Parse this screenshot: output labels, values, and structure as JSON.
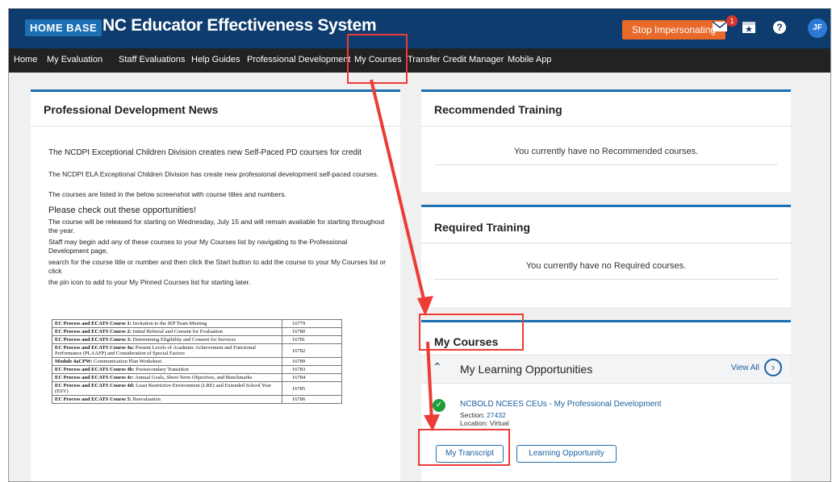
{
  "header": {
    "logo": "HOME BASE",
    "title": "NC Educator Effectiveness System",
    "stop_button": "Stop Impersonating",
    "mail_badge": "1",
    "avatar": "JF",
    "help_icon": "?"
  },
  "nav": [
    "Home",
    "My Evaluation",
    "Staff Evaluations",
    "Help Guides",
    "Professional Development",
    "My Courses",
    "Transfer Credit Manager",
    "Mobile App"
  ],
  "news": {
    "title": "Professional Development News",
    "headline": "The NCDPI Exceptional Children Division creates new Self-Paced PD courses for credit",
    "p1": "The NCDPI ELA Exceptional Children Division has create new professional development self-paced courses.",
    "p2": "The courses are listed in the below screenshot with course titles and numbers.",
    "subhead": "Please check out these opportunities!",
    "p3": "The course will be released for starting on Wednesday, July 15 and will remain available for starting throughout the year.",
    "p4": "Staff may begin add any of these courses to your My Courses list by navigating to the Professional Development page,",
    "p5": "search for the course title or number and then click the Start button to add the course to your My Courses list or click",
    "p6": "the pin icon to add to your My Pinned Courses list for starting later.",
    "courses": [
      {
        "bold": "EC Process and ECATS Course 1:",
        "rest": " Invitation to the IEP Team Meeting",
        "num": "16779"
      },
      {
        "bold": "EC Process and ECATS Course 2:",
        "rest": " Initial Referral and Consent for Evaluation",
        "num": "16780"
      },
      {
        "bold": "EC Process and ECATS Course 3:",
        "rest": " Determining Eligibility and Consent for Services",
        "num": "16781"
      },
      {
        "bold": "EC Process and ECATS Course 4a:",
        "rest": " Present Levels of Academic Achievement and Functional Performance (PLAAFP) and Consideration of Special Factors",
        "num": "16782"
      },
      {
        "bold": "Module 4aCPW:",
        "rest": " Communication Plan Worksheet",
        "num": "16789"
      },
      {
        "bold": "EC Process and ECATS Course 4b:",
        "rest": " Postsecondary Transition",
        "num": "16783"
      },
      {
        "bold": "EC Process and ECATS Course 4c:",
        "rest": " Annual Goals, Short-Term Objectives, and Benchmarks",
        "num": "16784"
      },
      {
        "bold": "EC Process and ECATS Course 4d:",
        "rest": " Least Restrictive Environment (LRE) and Extended School Year (ESY)",
        "num": "16785"
      },
      {
        "bold": "EC Process and ECATS Course 5:",
        "rest": " Reevaluation",
        "num": "16786"
      }
    ]
  },
  "recommended": {
    "title": "Recommended Training",
    "message": "You currently have no Recommended courses."
  },
  "required": {
    "title": "Required Training",
    "message": "You currently have no Required courses."
  },
  "my_courses": {
    "title": "My Courses",
    "section_title": "My Learning Opportunities",
    "view_all": "View All",
    "course_name": "NCBOLD NCEES CEUs - My Professional Development",
    "section_label": "Section: ",
    "section_value": "27432",
    "location": "Location: Virtual",
    "transcript_button": "My Transcript",
    "learning_button": "Learning Opportunity"
  },
  "colors": {
    "header": "#0e3c6e",
    "nav": "#222222",
    "accent": "#1b6fb3",
    "stop": "#e8692a",
    "highlight": "#ee3b36",
    "success": "#1e9e3a"
  }
}
